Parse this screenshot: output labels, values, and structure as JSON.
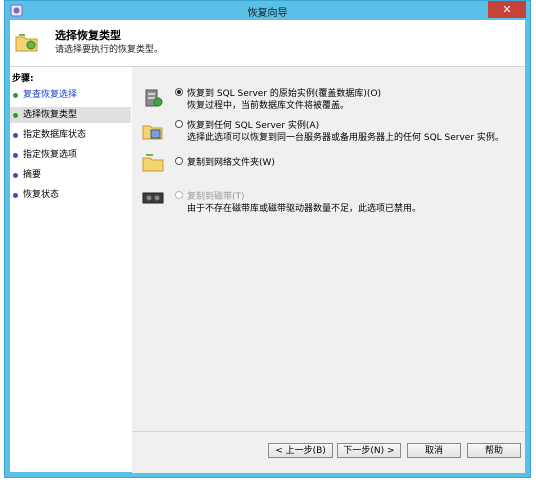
{
  "window": {
    "title": "恢复向导",
    "close_label": "✕"
  },
  "header": {
    "title": "选择恢复类型",
    "subtitle": "请选择要执行的恢复类型。"
  },
  "steps": {
    "title": "步骤:",
    "items": [
      {
        "label": "复查恢复选择",
        "color": "#2aa02a",
        "text_color": "#1a3fd1"
      },
      {
        "label": "选择恢复类型",
        "color": "#2aa02a",
        "text_color": "#000000"
      },
      {
        "label": "指定数据库状态",
        "color": "#5a3fb8",
        "text_color": "#000000"
      },
      {
        "label": "指定恢复选项",
        "color": "#5a3fb8",
        "text_color": "#000000"
      },
      {
        "label": "摘要",
        "color": "#5a3fb8",
        "text_color": "#000000"
      },
      {
        "label": "恢复状态",
        "color": "#5a3fb8",
        "text_color": "#000000"
      }
    ]
  },
  "options": [
    {
      "label": "恢复到 SQL Server 的原始实例(覆盖数据库)(O)",
      "desc": "恢复过程中，当前数据库文件将被覆盖。",
      "checked": true,
      "disabled": false
    },
    {
      "label": "恢复到任何 SQL Server 实例(A)",
      "desc": "选择此选项可以恢复到同一台服务器或备用服务器上的任何 SQL Server 实例。",
      "checked": false,
      "disabled": false
    },
    {
      "label": "复制到网络文件夹(W)",
      "desc": "",
      "checked": false,
      "disabled": false
    },
    {
      "label": "复制到磁带(T)",
      "desc": "由于不存在磁带库或磁带驱动器数量不足，此选项已禁用。",
      "checked": false,
      "disabled": true
    }
  ],
  "buttons": {
    "prev": "< 上一步(B)",
    "next": "下一步(N) >",
    "cancel": "取消",
    "help": "帮助"
  }
}
